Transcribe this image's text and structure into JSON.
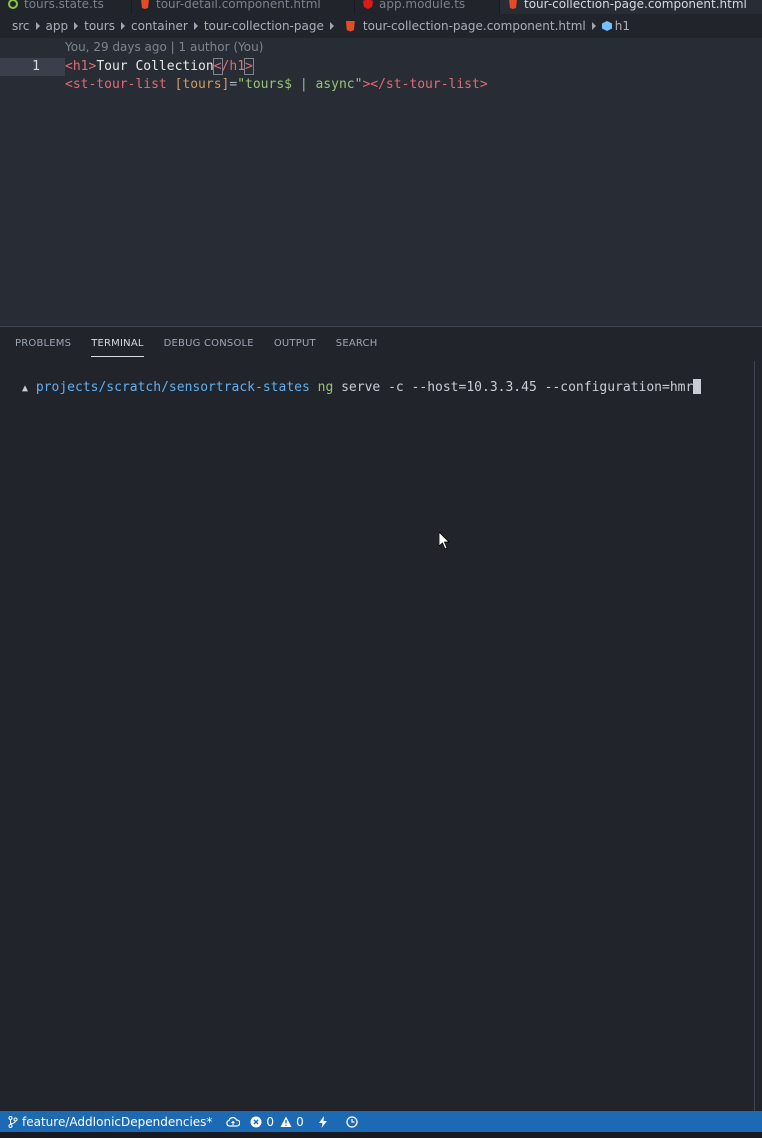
{
  "tabs": [
    {
      "label": "tours.state.ts",
      "icon": "typescript-file-icon",
      "active": false
    },
    {
      "label": "tour-detail.component.html",
      "icon": "html-file-icon",
      "active": false
    },
    {
      "label": "app.module.ts",
      "icon": "angular-file-icon",
      "active": false
    },
    {
      "label": "tour-collection-page.component.html",
      "icon": "html-file-icon",
      "active": true
    }
  ],
  "breadcrumb": {
    "items": [
      "src",
      "app",
      "tours",
      "container",
      "tour-collection-page",
      "tour-collection-page.component.html",
      "h1"
    ]
  },
  "editor": {
    "blame": "You, 29 days ago | 1 author (You)",
    "line_number": "1",
    "line1": {
      "open_tag": "<h1>",
      "text": "Tour Collection",
      "close_lt": "<",
      "close_tag": "/h1",
      "close_gt": ">"
    },
    "line2": {
      "open": "<st-tour-list",
      "attr": "[tours]",
      "eq": "=",
      "quote": "\"",
      "value": "tours$ | async",
      "close": ">",
      "end_tag": "</st-tour-list>"
    }
  },
  "panel": {
    "tabs": [
      "PROBLEMS",
      "TERMINAL",
      "DEBUG CONSOLE",
      "OUTPUT",
      "SEARCH"
    ],
    "active_tab": "TERMINAL"
  },
  "terminal": {
    "prompt_arrow": "▲",
    "path": "projects/scratch/sensortrack-states",
    "command": "ng",
    "args": "serve -c --host=10.3.3.45 --configuration=hmr"
  },
  "statusbar": {
    "branch": "feature/AddIonicDependencies*",
    "errors": "0",
    "warnings": "0"
  },
  "colors": {
    "statusbar_bg": "#1c6ab3",
    "editor_bg": "#282c34",
    "panel_bg": "#21252b"
  }
}
